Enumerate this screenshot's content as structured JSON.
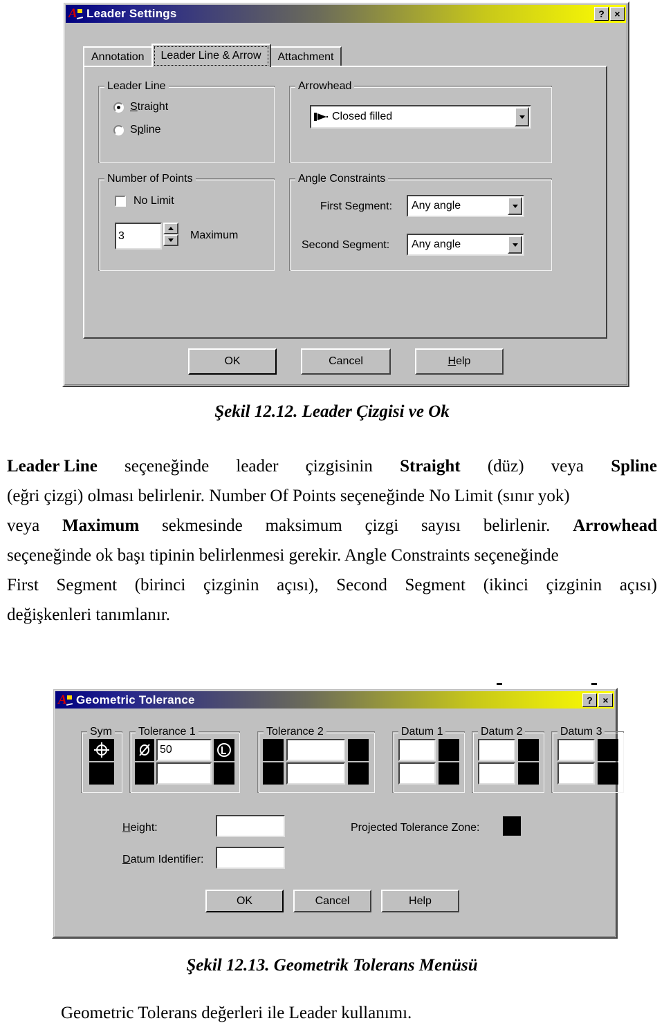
{
  "leader_dialog": {
    "title": "Leader Settings",
    "titlebar_buttons": [
      {
        "name": "help-question-button",
        "label": "?"
      },
      {
        "name": "close-button",
        "label": "×"
      }
    ],
    "tabs": [
      {
        "label": "Annotation",
        "active": false
      },
      {
        "label": "Leader Line & Arrow",
        "active": true
      },
      {
        "label": "Attachment",
        "active": false
      }
    ],
    "leader_line": {
      "group_label": "Leader Line",
      "options": [
        {
          "label": "Straight",
          "selected": true
        },
        {
          "label": "Spline",
          "selected": false
        }
      ]
    },
    "number_of_points": {
      "group_label": "Number of Points",
      "no_limit_label": "No Limit",
      "no_limit_checked": false,
      "maximum_value": "3",
      "maximum_label": "Maximum"
    },
    "arrowhead": {
      "group_label": "Arrowhead",
      "value": "Closed filled"
    },
    "angle_constraints": {
      "group_label": "Angle Constraints",
      "first_segment_label": "First Segment:",
      "first_segment_value": "Any angle",
      "second_segment_label": "Second Segment:",
      "second_segment_value": "Any angle"
    },
    "buttons": {
      "ok": "OK",
      "cancel": "Cancel",
      "help": "Help"
    }
  },
  "figure_12_12_caption": "Şekil 12.12. Leader Çizgisi ve Ok",
  "paragraph": {
    "line1_a": "Leader Line",
    "line1_b": "seçeneğinde",
    "line1_c": "leader",
    "line1_d": "çizgisinin",
    "line1_e": "Straight",
    "line1_f": "(düz)",
    "line1_g": "veya",
    "line1_h": "Spline",
    "line2": "(eğri çizgi) olması belirlenir. Number Of Points seçeneğinde No Limit (sınır yok)",
    "line3_a": "veya",
    "line3_b": "Maximum",
    "line3_c": "sekmesinde",
    "line3_d": "maksimum",
    "line3_e": "çizgi",
    "line3_f": "sayısı",
    "line3_g": "belirlenir.",
    "line3_h": "Arrowhead",
    "line4": "seçeneğinde ok başı tipinin belirlenmesi gerekir. Angle Constraints seçeneğinde",
    "line5_a": "First",
    "line5_b": "Segment",
    "line5_c": "(birinci",
    "line5_d": "çizginin",
    "line5_e": "açısı),",
    "line5_f": "Second",
    "line5_g": "Segment",
    "line5_h": "(ikinci",
    "line5_i": "çizginin",
    "line5_j": "açısı)",
    "line6": "değişkenleri tanımlanır."
  },
  "tolerance_dialog": {
    "title": "Geometric Tolerance",
    "titlebar_buttons": [
      {
        "name": "help-question-button",
        "label": "?"
      },
      {
        "name": "close-button",
        "label": "×"
      }
    ],
    "groups": [
      {
        "label": "Sym"
      },
      {
        "label": "Tolerance 1"
      },
      {
        "label": "Tolerance 2"
      },
      {
        "label": "Datum 1"
      },
      {
        "label": "Datum 2"
      },
      {
        "label": "Datum 3"
      }
    ],
    "sym": {
      "row1_symbol": "position-symbol",
      "row2_symbol": "empty"
    },
    "tolerance1": {
      "row1_prefix_symbol": "diameter-symbol",
      "row1_value": "50",
      "row1_suffix_symbol": "lmc-symbol",
      "row2_value": ""
    },
    "tolerance2": {
      "row1_value": "",
      "row2_value": ""
    },
    "datum1": {
      "row1_value": "",
      "row2_value": ""
    },
    "datum2": {
      "row1_value": "",
      "row2_value": ""
    },
    "datum3": {
      "row1_value": "",
      "row2_value": ""
    },
    "height_label": "Height:",
    "height_value": "",
    "datum_identifier_label": "Datum Identifier:",
    "datum_identifier_value": "",
    "projected_tolerance_zone_label": "Projected Tolerance Zone:",
    "buttons": {
      "ok": "OK",
      "cancel": "Cancel",
      "help": "Help"
    }
  },
  "figure_12_13_caption": "Şekil 12.13. Geometrik Tolerans Menüsü",
  "closing_text": "Geometric Tolerans değerleri ile Leader kullanımı."
}
